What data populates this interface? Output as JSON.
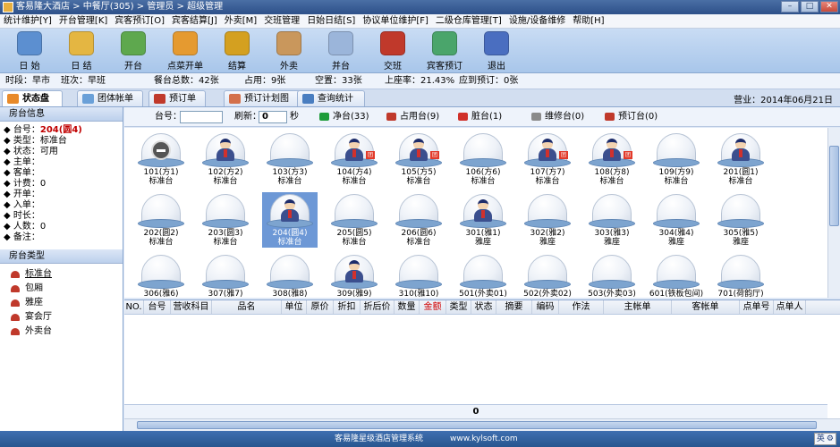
{
  "titlebar": {
    "title": "客易隆大酒店 > 中餐厅(305) > 管理员 > 超级管理"
  },
  "menu": [
    "统计维护[Y]",
    "开台管理[K]",
    "宾客预订[O]",
    "宾客结算[J]",
    "外卖[M]",
    "交班管理",
    "日始日结[S]",
    "协议单位维护[F]",
    "二级仓库管理[T]",
    "设施/设备维修",
    "帮助[H]"
  ],
  "toolbar": [
    {
      "label": "日 始",
      "icon": "clock-icon",
      "color": "#5c8fd0"
    },
    {
      "label": "日 结",
      "icon": "bell-icon",
      "color": "#e4b642"
    },
    {
      "label": "开台",
      "icon": "table-open-icon",
      "color": "#5ea84e"
    },
    {
      "label": "点菜开单",
      "icon": "order-add-icon",
      "color": "#e59a30"
    },
    {
      "label": "结算",
      "icon": "money-icon",
      "color": "#d4a020"
    },
    {
      "label": "外卖",
      "icon": "takeout-icon",
      "color": "#c9975c"
    },
    {
      "label": "并台",
      "icon": "merge-icon",
      "color": "#9bb5da"
    },
    {
      "label": "交班",
      "icon": "handover-icon",
      "color": "#c0392b"
    },
    {
      "label": "宾客预订",
      "icon": "reservation-icon",
      "color": "#4aa56b"
    },
    {
      "label": "退出",
      "icon": "exit-icon",
      "color": "#4a6ec0"
    }
  ],
  "status": {
    "period": "时段：早市",
    "shift": "班次：早班",
    "total": "餐台总数：42张",
    "occupied": "占用：9张",
    "empty": "空置：33张",
    "rate": "上座率：21.43%",
    "booked": "应到预订：0张"
  },
  "tabs": [
    "状态盘",
    "团体帐单",
    "预订单",
    "预订计划图",
    "查询统计"
  ],
  "business_date": "营业：2014年06月21日",
  "left": {
    "info_title": "房台信息",
    "info": [
      {
        "label": "◆ 台号：",
        "value": "204(圆4)",
        "red": true
      },
      {
        "label": "◆ 类型：",
        "value": "标准台"
      },
      {
        "label": "◆ 状态：",
        "value": "可用"
      },
      {
        "label": "◆ 主单：",
        "value": ""
      },
      {
        "label": "◆ 客单：",
        "value": ""
      },
      {
        "label": "◆ 计费：",
        "value": "0"
      },
      {
        "label": "◆ 开单：",
        "value": ""
      },
      {
        "label": "◆ 入单：",
        "value": ""
      },
      {
        "label": "◆ 时长：",
        "value": ""
      },
      {
        "label": "◆ 人数：",
        "value": "0"
      },
      {
        "label": "◆ 备注：",
        "value": ""
      }
    ],
    "types_title": "房台类型",
    "types": [
      "标准台",
      "包厢",
      "雅座",
      "宴会厅",
      "外卖台"
    ]
  },
  "filter": {
    "table_label": "台号：",
    "table_value": "",
    "refresh_label": "刷新：",
    "refresh_value": "0",
    "seconds": "秒",
    "legend": [
      {
        "label": "净台(33)",
        "color": "#1e9c3a"
      },
      {
        "label": "占用台(9)",
        "color": "#c0392b"
      },
      {
        "label": "脏台(1)",
        "color": "#d0302a"
      },
      {
        "label": "维修台(0)",
        "color": "#8a8a8a"
      },
      {
        "label": "预订台(0)",
        "color": "#c0392b"
      }
    ]
  },
  "tables": [
    {
      "name": "101(方1)",
      "type": "标准台",
      "state": "disabled"
    },
    {
      "name": "102(方2)",
      "type": "标准台",
      "state": "occupied"
    },
    {
      "name": "103(方3)",
      "type": "标准台",
      "state": "empty"
    },
    {
      "name": "104(方4)",
      "type": "标准台",
      "state": "occupied-tag"
    },
    {
      "name": "105(方5)",
      "type": "标准台",
      "state": "occupied-tag"
    },
    {
      "name": "106(方6)",
      "type": "标准台",
      "state": "empty"
    },
    {
      "name": "107(方7)",
      "type": "标准台",
      "state": "occupied-tag"
    },
    {
      "name": "108(方8)",
      "type": "标准台",
      "state": "occupied-tag"
    },
    {
      "name": "109(方9)",
      "type": "标准台",
      "state": "empty"
    },
    {
      "name": "201(圆1)",
      "type": "标准台",
      "state": "occupied"
    },
    {
      "name": "202(圆2)",
      "type": "标准台",
      "state": "empty"
    },
    {
      "name": "203(圆3)",
      "type": "标准台",
      "state": "empty"
    },
    {
      "name": "204(圆4)",
      "type": "标准台",
      "state": "selected"
    },
    {
      "name": "205(圆5)",
      "type": "标准台",
      "state": "empty"
    },
    {
      "name": "206(圆6)",
      "type": "标准台",
      "state": "empty"
    },
    {
      "name": "301(雅1)",
      "type": "雅座",
      "state": "occupied"
    },
    {
      "name": "302(雅2)",
      "type": "雅座",
      "state": "empty"
    },
    {
      "name": "303(雅3)",
      "type": "雅座",
      "state": "empty"
    },
    {
      "name": "304(雅4)",
      "type": "雅座",
      "state": "empty"
    },
    {
      "name": "305(雅5)",
      "type": "雅座",
      "state": "empty"
    },
    {
      "name": "306(雅6)",
      "type": "雅座",
      "state": "empty"
    },
    {
      "name": "307(雅7)",
      "type": "雅座",
      "state": "empty"
    },
    {
      "name": "308(雅8)",
      "type": "雅座",
      "state": "empty"
    },
    {
      "name": "309(雅9)",
      "type": "雅座",
      "state": "occupied"
    },
    {
      "name": "310(雅10)",
      "type": "雅座",
      "state": "empty"
    },
    {
      "name": "501(外卖01)",
      "type": "外卖台",
      "state": "empty"
    },
    {
      "name": "502(外卖02)",
      "type": "外卖台",
      "state": "empty"
    },
    {
      "name": "503(外卖03)",
      "type": "外卖台",
      "state": "empty"
    },
    {
      "name": "601(铁板包间)",
      "type": "包厢",
      "state": "empty"
    },
    {
      "name": "701(荷韵厅)",
      "type": "宴会厅",
      "state": "empty"
    }
  ],
  "columns": [
    {
      "label": "NO.",
      "w": 22
    },
    {
      "label": "台号",
      "w": 30
    },
    {
      "label": "营收科目",
      "w": 46
    },
    {
      "label": "品名",
      "w": 78
    },
    {
      "label": "单位",
      "w": 28
    },
    {
      "label": "原价",
      "w": 30
    },
    {
      "label": "折扣",
      "w": 30
    },
    {
      "label": "折后价",
      "w": 38
    },
    {
      "label": "数量",
      "w": 28
    },
    {
      "label": "金额",
      "w": 30,
      "red": true
    },
    {
      "label": "类型",
      "w": 28
    },
    {
      "label": "状态",
      "w": 28
    },
    {
      "label": "摘要",
      "w": 40
    },
    {
      "label": "编码",
      "w": 30
    },
    {
      "label": "作法",
      "w": 50
    },
    {
      "label": "主帐单",
      "w": 76
    },
    {
      "label": "客帐单",
      "w": 76
    },
    {
      "label": "点单号",
      "w": 38
    },
    {
      "label": "点单人",
      "w": 36
    }
  ],
  "total_amount": "0",
  "footer": {
    "brand": "客易隆星级酒店管理系统",
    "url": "www.kylsoft.com",
    "ime": "英"
  }
}
